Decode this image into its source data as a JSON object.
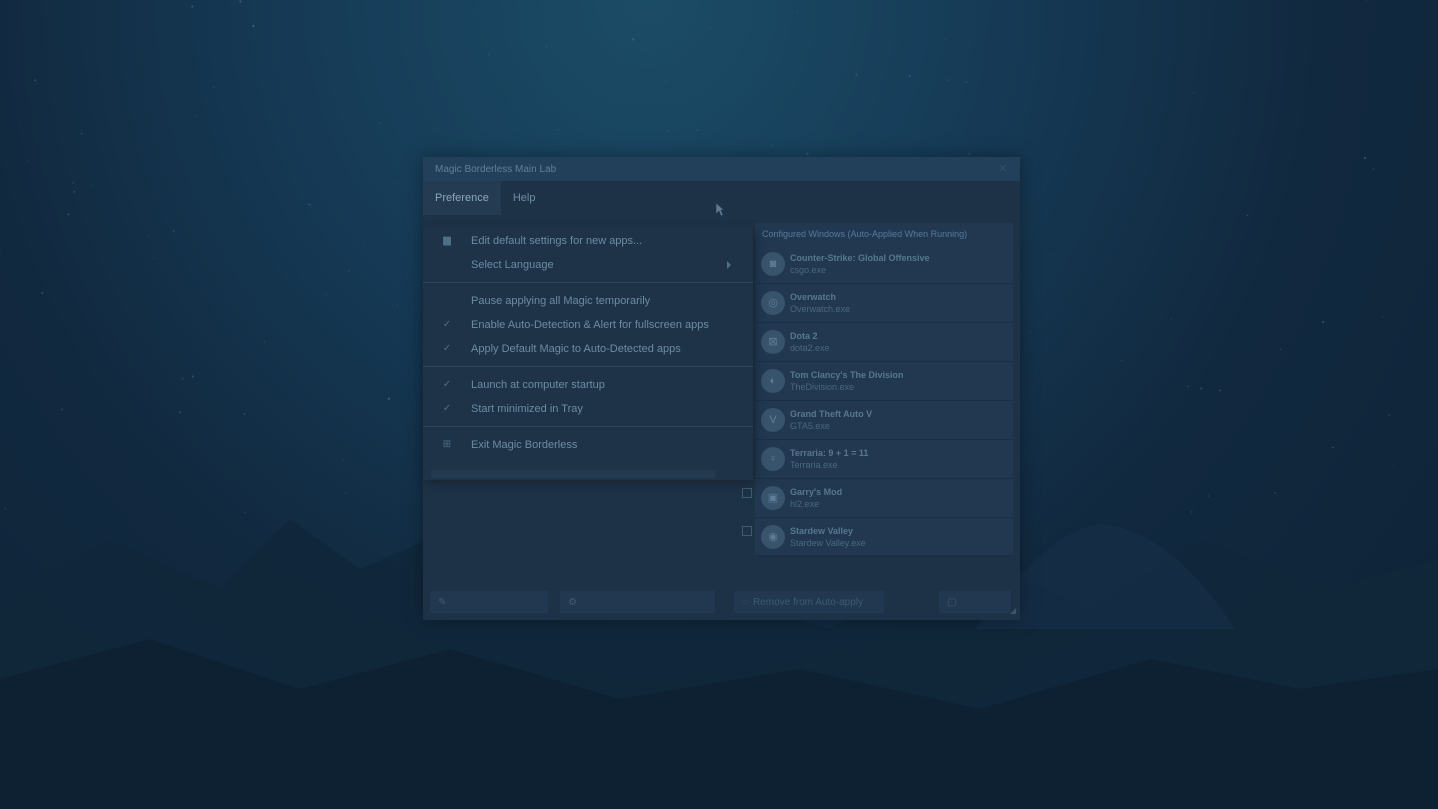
{
  "window": {
    "title": "Magic Borderless Main Lab",
    "close_glyph": "✕"
  },
  "menubar": {
    "tabs": [
      {
        "label": "Preference",
        "active": true
      },
      {
        "label": "Help",
        "active": false
      }
    ]
  },
  "preference_menu": {
    "items": [
      {
        "label": "Edit default settings for new apps...",
        "icon": "folder-icon",
        "checked": false
      },
      {
        "label": "Select Language",
        "icon": "",
        "has_submenu": true
      },
      {
        "label": "Pause applying all Magic temporarily",
        "checked": false
      },
      {
        "label": "Enable Auto-Detection & Alert for fullscreen apps",
        "checked": true
      },
      {
        "label": "Apply Default Magic to Auto-Detected apps",
        "checked": true
      },
      {
        "label": "Launch at computer startup",
        "checked": true
      },
      {
        "label": "Start minimized in Tray",
        "checked": true
      },
      {
        "label": "Exit Magic Borderless",
        "icon": "exit-icon"
      }
    ]
  },
  "configured_panel": {
    "header": "Configured Windows (Auto-Applied When Running)",
    "apps": [
      {
        "name": "Counter-Strike: Global Offensive",
        "exe": "csgo.exe",
        "icon": "csgo-icon"
      },
      {
        "name": "Overwatch",
        "exe": "Overwatch.exe",
        "icon": "overwatch-icon"
      },
      {
        "name": "Dota 2",
        "exe": "dota2.exe",
        "icon": "dota2-icon"
      },
      {
        "name": "Tom Clancy's The Division",
        "exe": "TheDivision.exe",
        "icon": "division-icon"
      },
      {
        "name": "Grand Theft Auto V",
        "exe": "GTA5.exe",
        "icon": "gta5-icon"
      },
      {
        "name": "Terraria: 9 + 1 = 11",
        "exe": "Terraria.exe",
        "icon": "terraria-icon"
      },
      {
        "name": "Garry's Mod",
        "exe": "hl2.exe",
        "icon": "garrysmod-icon"
      },
      {
        "name": "Stardew Valley",
        "exe": "Stardew Valley.exe",
        "icon": "stardew-icon"
      }
    ]
  },
  "icons": {
    "folder": "▆",
    "check": "✓",
    "exit": "⊞",
    "csgo": "◙",
    "overwatch": "◎",
    "dota2": "⊠",
    "division": "◐",
    "gta5": "V",
    "terraria": "♀",
    "garrysmod": "▣",
    "stardew": "◉",
    "bottom_btn1": "✎",
    "bottom_btn2": "⚙",
    "bottom_btn3": "◌",
    "bottom_btn4": "▢"
  },
  "bottom_bar": {
    "buttons": [
      {
        "label": "",
        "icon": "edit-icon"
      },
      {
        "label": "",
        "icon": "settings-icon"
      },
      {
        "label": "Remove from Auto-apply",
        "icon": "remove-icon"
      },
      {
        "label": "",
        "icon": "save-icon"
      }
    ]
  },
  "colors": {
    "overlay_dim": "#0e2235",
    "window_bg": "#1e3247",
    "titlebar_bg": "#22405a"
  }
}
